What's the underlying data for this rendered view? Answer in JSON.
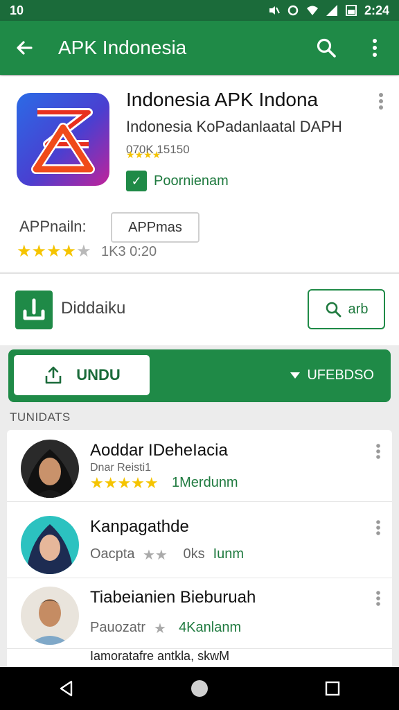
{
  "status_bar": {
    "left_text": "10",
    "time": "2:24"
  },
  "app_bar": {
    "title": "APK Indonesia"
  },
  "app": {
    "title": "Indonesia APK Indona",
    "developer": "Indonesia KoPadanlaatal DAPH",
    "meta_line": "070K 15150",
    "badge_label": "Poornienam",
    "label": "APPnailn:",
    "button_label": "APPmas",
    "rating": 4.5,
    "rating_meta": "1K3 0:20"
  },
  "install": {
    "label": "Diddaiku",
    "search_label": "arb"
  },
  "banner": {
    "primary_label": "UNDU",
    "secondary_label": "UFEBDSO"
  },
  "section_header": "TUNIDATS",
  "reviews": [
    {
      "name": "Aoddar IDeheIacia",
      "sub": "Dnar Reisti1",
      "rating": 5,
      "meta": "1Merdunm"
    },
    {
      "name": "Kanpagathde",
      "sub2": "Oacpta",
      "rating": 2,
      "meta": "0ks",
      "green": "Iunm"
    },
    {
      "name": "Tiabeianien Bieburuah",
      "sub2": "Pauozatr",
      "rating": 1,
      "meta": "4Kanlanm"
    }
  ],
  "partial_item": "Iamoratafre antkla, skwM",
  "colors": {
    "primary": "#1f8a47",
    "primary_dark": "#1b6b3a",
    "star": "#f5c400"
  }
}
